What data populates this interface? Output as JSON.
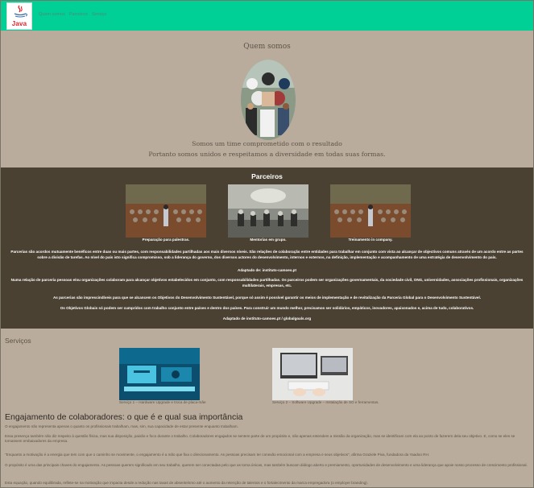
{
  "header": {
    "logo_text": "Java",
    "nav": [
      "Quem somos",
      "Parceiros",
      "Serviço"
    ]
  },
  "quem_somos": {
    "title": "Quem somos",
    "line1": "Somos um time comprometido com o resultado",
    "line2": "Portanto somos unidos e respeitamos a diversidade em todas suas formas."
  },
  "parceiros": {
    "title": "Parceiros",
    "captions": [
      "Preparação para palestras.",
      "Mentorias em grupo.",
      "Treinamento in company."
    ],
    "para1": "Parcerias são acordos mutuamente benéficos entre duas ou mais partes, com responsabilidades partilhadas aos mais diversos níveis. São relações de colaboração entre entidades para trabalhar em conjunto com vista ao alcançar de objectivos comuns através de um acordo entre as partes sobre a divisão de tarefas. Ao nível do país isto significa compromisso, sob a liderança do governo, dos diversos actores do desenvolvimento, internos e externos, na definição, implementação e acompanhamento de uma estratégia de desenvolvimento do país.",
    "source1": "Adaptado de: instituto-camoes.pt",
    "para2": "Numa relação de parceria pessoas e/ou organizações colaboram para alcançar objetivos estabelecidos em conjunto, com responsabilidades partilhadas. Os parceiros podem ser organizações governamentais, da sociedade civil, ONG, universidades, associações profissionais, organizações multilaterais, empresas, etc.",
    "para3": "As parcerias são imprescindíveis para que se alcancem os Objetivos do Desenvolvimento Sustentável, porque só assim é possível garantir os meios de implementação e de revitalização da Parceria Global para o Desenvolvimento Sustentável.",
    "para4": "Os Objetivos Globais só podem ser cumpridos com trabalho conjunto entre países e dentro dos países. Para construir um mundo melhor, precisamos ser solidários, empáticos, inovadores, apaixonados e, acima de tudo, colaborativos.",
    "source2": "Adaptado de instituto-camoes.pt / globalgoals.org"
  },
  "servicos": {
    "title": "Serviços",
    "captions": [
      "Serviço 1 – Hardware Upgrade e troca de placa-mãe",
      "Serviço 2 – Software Upgrade – Instalação de SO e ferramentas."
    ]
  },
  "engajamento": {
    "title": "Engajamento de colaboradores: o que é e qual sua importância",
    "paragraphs": [
      "O engajamento não representa apenas o quanto os profissionais trabalham, mas, sim, sua capacidade de estar presente enquanto trabalham.",
      "Essa presença também não diz respeito à questão física, mas sua disposição, paixão e foco durante o trabalho. Colaboradores engajados se sentem parte de um propósito e, não apenas entendem a missão da organização, mas se identificam com ela ao ponto de fazerem dela seu objetivo. E, como se eles se tornassem embaixadores da empresa.",
      "\"Enquanto a motivação é a energia que tem com que o caminho se movimente, o engajamento é a mão que fixa o direcionamento. As pessoas precisam ter conexão emocional com a empresa e seus objetivos\", afirma Graziele Piva, fundadora da Yaadoo RH.",
      "O propósito é uma das principais chaves do engajamento. As pessoas querem significado em seu trabalho, querem ser conectadas pelo que as torna únicas, mas também buscam diálogo aberto e premiamento, oportunidades de desenvolvimento e uma liderança que apoie nosso processo de crescimento profissional.",
      "Esta equação, quando equilibrada, reflete-se na motivação que impacta desde a redução nas taxas de absenteísmo até o aumento da retenção de talentos e o fortalecimento da marca empregadora (o employer branding)."
    ]
  },
  "colors": {
    "nav_bg": "#00cf96",
    "light_section": "#b9ac9c",
    "dark_section": "#4a4132",
    "logo_red": "#e3232a",
    "logo_blue": "#3c6fa8"
  }
}
